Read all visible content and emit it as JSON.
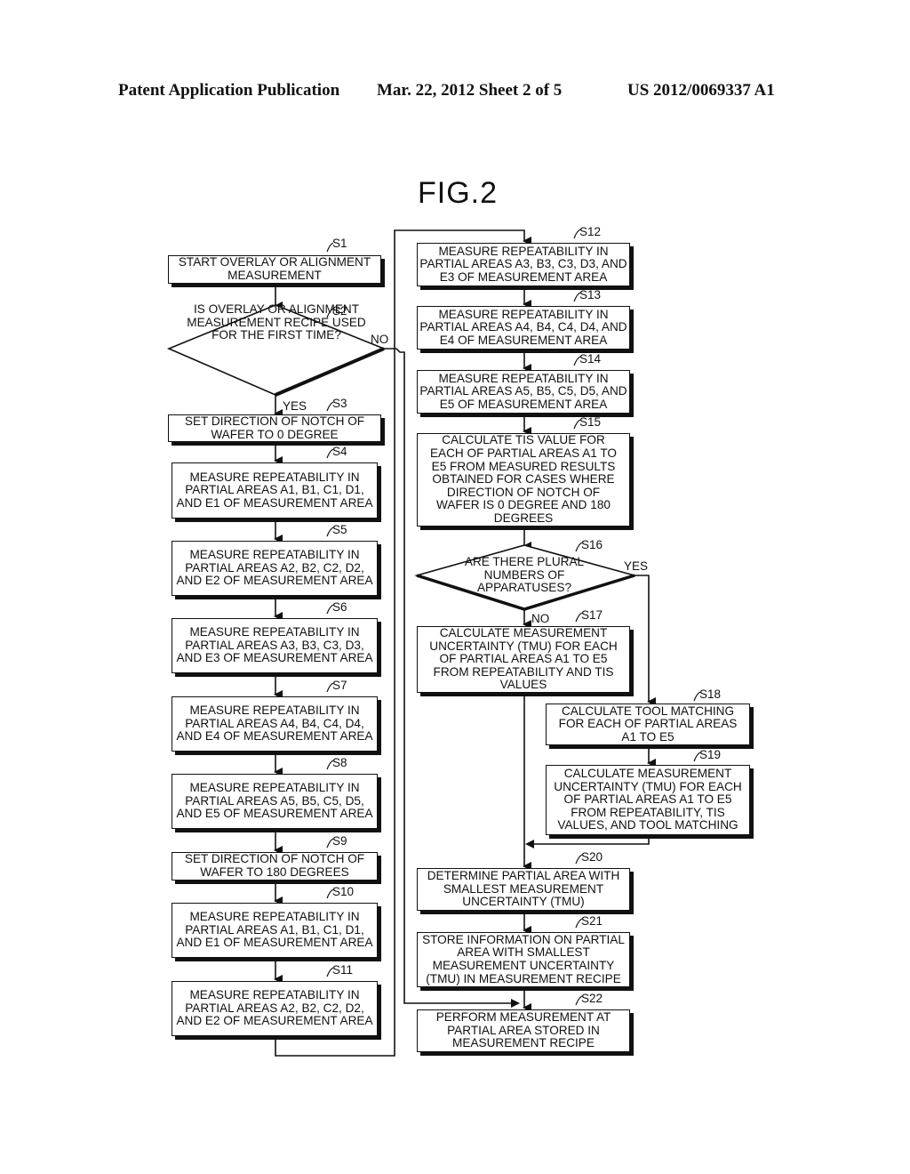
{
  "header": {
    "publication": "Patent Application Publication",
    "date_sheet": "Mar. 22, 2012  Sheet 2 of 5",
    "number": "US 2012/0069337 A1"
  },
  "figure": {
    "title": "FIG.2"
  },
  "steps": {
    "s1": {
      "id": "S1",
      "text": "START OVERLAY OR ALIGNMENT MEASUREMENT"
    },
    "s2": {
      "id": "S2",
      "text": "IS OVERLAY OR ALIGNMENT MEASUREMENT RECIPE USED FOR THE FIRST TIME?",
      "yes": "YES",
      "no": "NO"
    },
    "s3": {
      "id": "S3",
      "text": "SET DIRECTION OF NOTCH OF WAFER TO 0 DEGREE"
    },
    "s4": {
      "id": "S4",
      "text": "MEASURE REPEATABILITY IN PARTIAL AREAS A1, B1, C1, D1, AND E1 OF MEASUREMENT AREA"
    },
    "s5": {
      "id": "S5",
      "text": "MEASURE REPEATABILITY IN PARTIAL AREAS A2, B2, C2, D2, AND E2 OF MEASUREMENT AREA"
    },
    "s6": {
      "id": "S6",
      "text": "MEASURE REPEATABILITY IN PARTIAL AREAS A3, B3, C3, D3, AND E3 OF MEASUREMENT AREA"
    },
    "s7": {
      "id": "S7",
      "text": "MEASURE REPEATABILITY IN PARTIAL AREAS A4, B4, C4, D4, AND E4 OF MEASUREMENT AREA"
    },
    "s8": {
      "id": "S8",
      "text": "MEASURE REPEATABILITY IN PARTIAL AREAS A5, B5, C5, D5, AND E5 OF MEASUREMENT AREA"
    },
    "s9": {
      "id": "S9",
      "text": "SET DIRECTION OF NOTCH OF WAFER TO 180 DEGREES"
    },
    "s10": {
      "id": "S10",
      "text": "MEASURE REPEATABILITY IN PARTIAL AREAS A1, B1, C1, D1, AND E1 OF MEASUREMENT AREA"
    },
    "s11": {
      "id": "S11",
      "text": "MEASURE REPEATABILITY IN PARTIAL AREAS A2, B2, C2, D2, AND E2 OF MEASUREMENT AREA"
    },
    "s12": {
      "id": "S12",
      "text": "MEASURE REPEATABILITY IN PARTIAL AREAS A3, B3, C3, D3, AND E3 OF MEASUREMENT AREA"
    },
    "s13": {
      "id": "S13",
      "text": "MEASURE REPEATABILITY IN PARTIAL AREAS A4, B4, C4, D4, AND E4 OF MEASUREMENT AREA"
    },
    "s14": {
      "id": "S14",
      "text": "MEASURE REPEATABILITY IN PARTIAL AREAS A5, B5, C5, D5, AND E5 OF MEASUREMENT AREA"
    },
    "s15": {
      "id": "S15",
      "text": "CALCULATE TIS VALUE FOR EACH OF PARTIAL AREAS A1 TO E5 FROM MEASURED RESULTS OBTAINED FOR CASES WHERE DIRECTION OF NOTCH OF WAFER IS 0 DEGREE AND 180 DEGREES"
    },
    "s16": {
      "id": "S16",
      "text": "ARE THERE PLURAL NUMBERS OF APPARATUSES?",
      "yes": "YES",
      "no": "NO"
    },
    "s17": {
      "id": "S17",
      "text": "CALCULATE MEASUREMENT UNCERTAINTY (TMU) FOR EACH OF PARTIAL AREAS A1 TO E5 FROM REPEATABILITY AND TIS VALUES"
    },
    "s18": {
      "id": "S18",
      "text": "CALCULATE TOOL MATCHING FOR EACH OF PARTIAL AREAS A1 TO E5"
    },
    "s19": {
      "id": "S19",
      "text": "CALCULATE MEASUREMENT UNCERTAINTY (TMU) FOR EACH OF PARTIAL AREAS A1 TO E5 FROM REPEATABILITY, TIS VALUES, AND TOOL MATCHING"
    },
    "s20": {
      "id": "S20",
      "text": "DETERMINE PARTIAL AREA WITH SMALLEST MEASUREMENT UNCERTAINTY (TMU)"
    },
    "s21": {
      "id": "S21",
      "text": "STORE INFORMATION ON PARTIAL AREA WITH SMALLEST MEASUREMENT UNCERTAINTY (TMU) IN MEASUREMENT RECIPE"
    },
    "s22": {
      "id": "S22",
      "text": "PERFORM MEASUREMENT AT PARTIAL AREA STORED IN MEASUREMENT RECIPE"
    }
  }
}
